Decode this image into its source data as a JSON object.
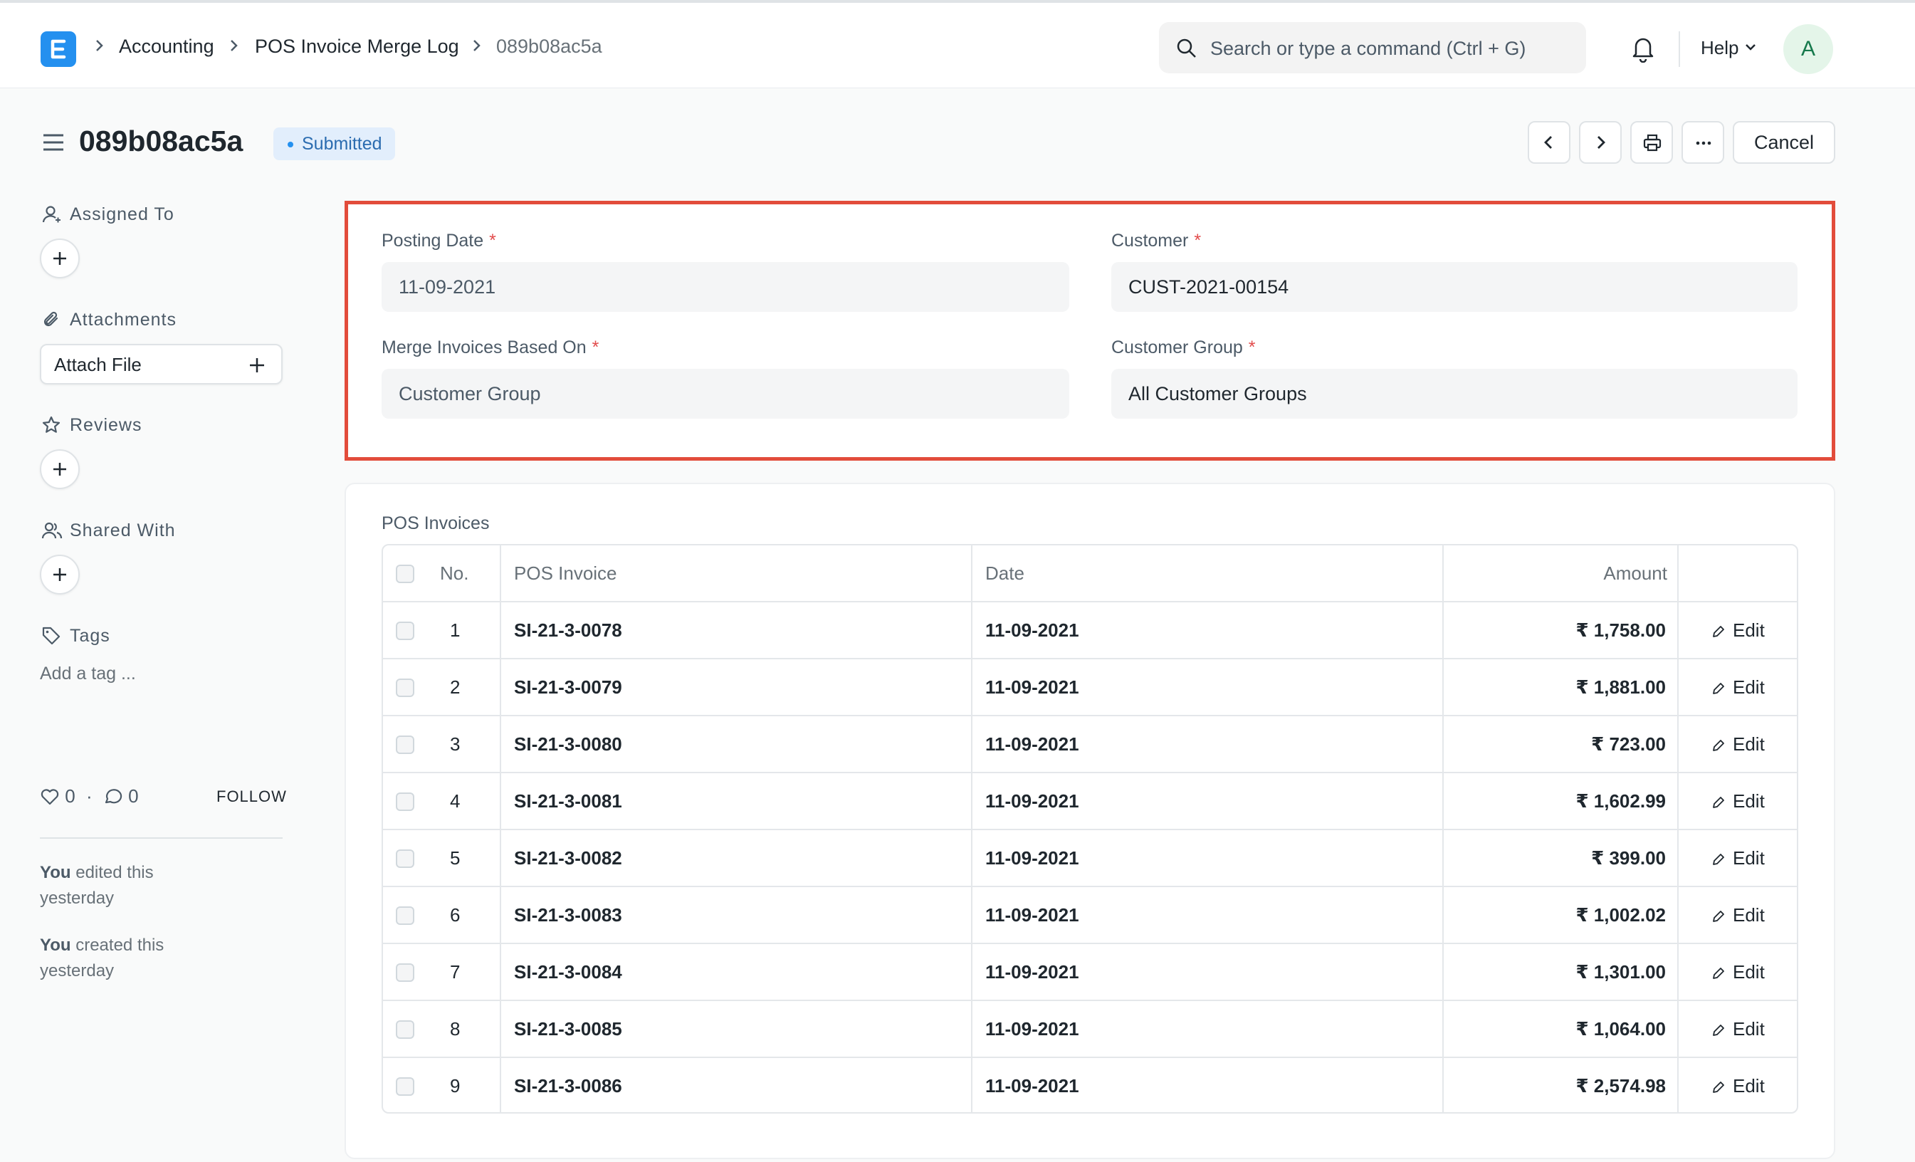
{
  "navbar": {
    "breadcrumbs": [
      "Accounting",
      "POS Invoice Merge Log",
      "089b08ac5a"
    ],
    "search_placeholder": "Search or type a command (Ctrl + G)",
    "help_label": "Help",
    "avatar_initial": "A"
  },
  "page": {
    "title": "089b08ac5a",
    "status": "Submitted",
    "cancel_label": "Cancel"
  },
  "sidebar": {
    "assigned_to": "Assigned To",
    "attachments": "Attachments",
    "attach_file": "Attach File",
    "reviews": "Reviews",
    "shared_with": "Shared With",
    "tags": "Tags",
    "add_tag": "Add a tag ...",
    "likes": "0",
    "comments": "0",
    "follow": "FOLLOW",
    "activity": [
      {
        "who": "You",
        "text": "edited this yesterday"
      },
      {
        "who": "You",
        "text": "created this yesterday"
      }
    ]
  },
  "form": {
    "posting_date_label": "Posting Date",
    "posting_date": "11-09-2021",
    "customer_label": "Customer",
    "customer": "CUST-2021-00154",
    "merge_based_on_label": "Merge Invoices Based On",
    "merge_based_on": "Customer Group",
    "customer_group_label": "Customer Group",
    "customer_group": "All Customer Groups"
  },
  "table": {
    "title": "POS Invoices",
    "headers": {
      "no": "No.",
      "invoice": "POS Invoice",
      "date": "Date",
      "amount": "Amount"
    },
    "edit_label": "Edit",
    "rows": [
      {
        "no": "1",
        "invoice": "SI-21-3-0078",
        "date": "11-09-2021",
        "amount": "₹ 1,758.00"
      },
      {
        "no": "2",
        "invoice": "SI-21-3-0079",
        "date": "11-09-2021",
        "amount": "₹ 1,881.00"
      },
      {
        "no": "3",
        "invoice": "SI-21-3-0080",
        "date": "11-09-2021",
        "amount": "₹ 723.00"
      },
      {
        "no": "4",
        "invoice": "SI-21-3-0081",
        "date": "11-09-2021",
        "amount": "₹ 1,602.99"
      },
      {
        "no": "5",
        "invoice": "SI-21-3-0082",
        "date": "11-09-2021",
        "amount": "₹ 399.00"
      },
      {
        "no": "6",
        "invoice": "SI-21-3-0083",
        "date": "11-09-2021",
        "amount": "₹ 1,002.02"
      },
      {
        "no": "7",
        "invoice": "SI-21-3-0084",
        "date": "11-09-2021",
        "amount": "₹ 1,301.00"
      },
      {
        "no": "8",
        "invoice": "SI-21-3-0085",
        "date": "11-09-2021",
        "amount": "₹ 1,064.00"
      },
      {
        "no": "9",
        "invoice": "SI-21-3-0086",
        "date": "11-09-2021",
        "amount": "₹ 2,574.98"
      }
    ]
  },
  "colors": {
    "accent": "#2490ef",
    "highlight_border": "#e24c3b",
    "status_badge_bg": "#e2eefc"
  }
}
